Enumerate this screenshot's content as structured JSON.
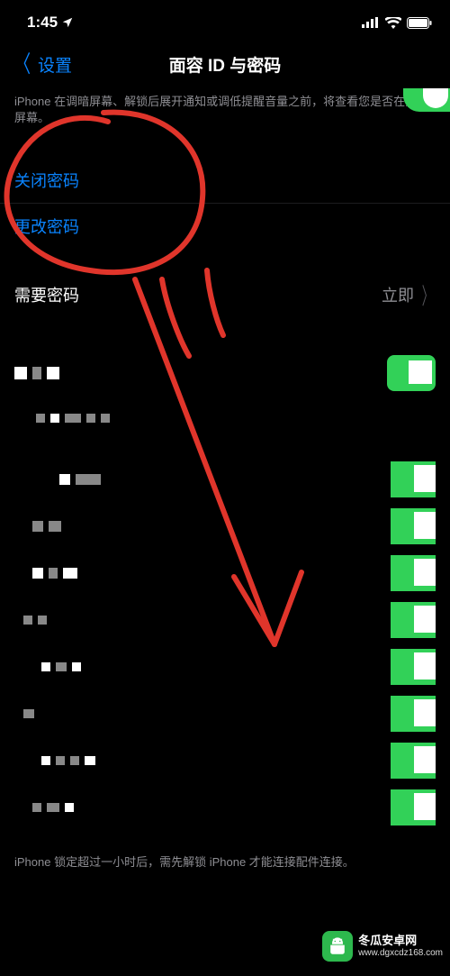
{
  "status_bar": {
    "time": "1:45",
    "location_icon": "location-arrow"
  },
  "nav": {
    "back_label": "设置",
    "title": "面容 ID 与密码"
  },
  "attention_footer": "iPhone 在调暗屏幕、解锁后展开通知或调低提醒音量之前，将查看您是否在注视屏幕。",
  "passcode_actions": {
    "turn_off": "关闭密码",
    "change": "更改密码"
  },
  "require_passcode": {
    "label": "需要密码",
    "value": "立即"
  },
  "bottom_footer": "iPhone 锁定超过一小时后，需先解锁 iPhone 才能连接配件连接。",
  "watermark": {
    "line1": "冬瓜安卓网",
    "line2": "www.dgxcdz168.com"
  }
}
